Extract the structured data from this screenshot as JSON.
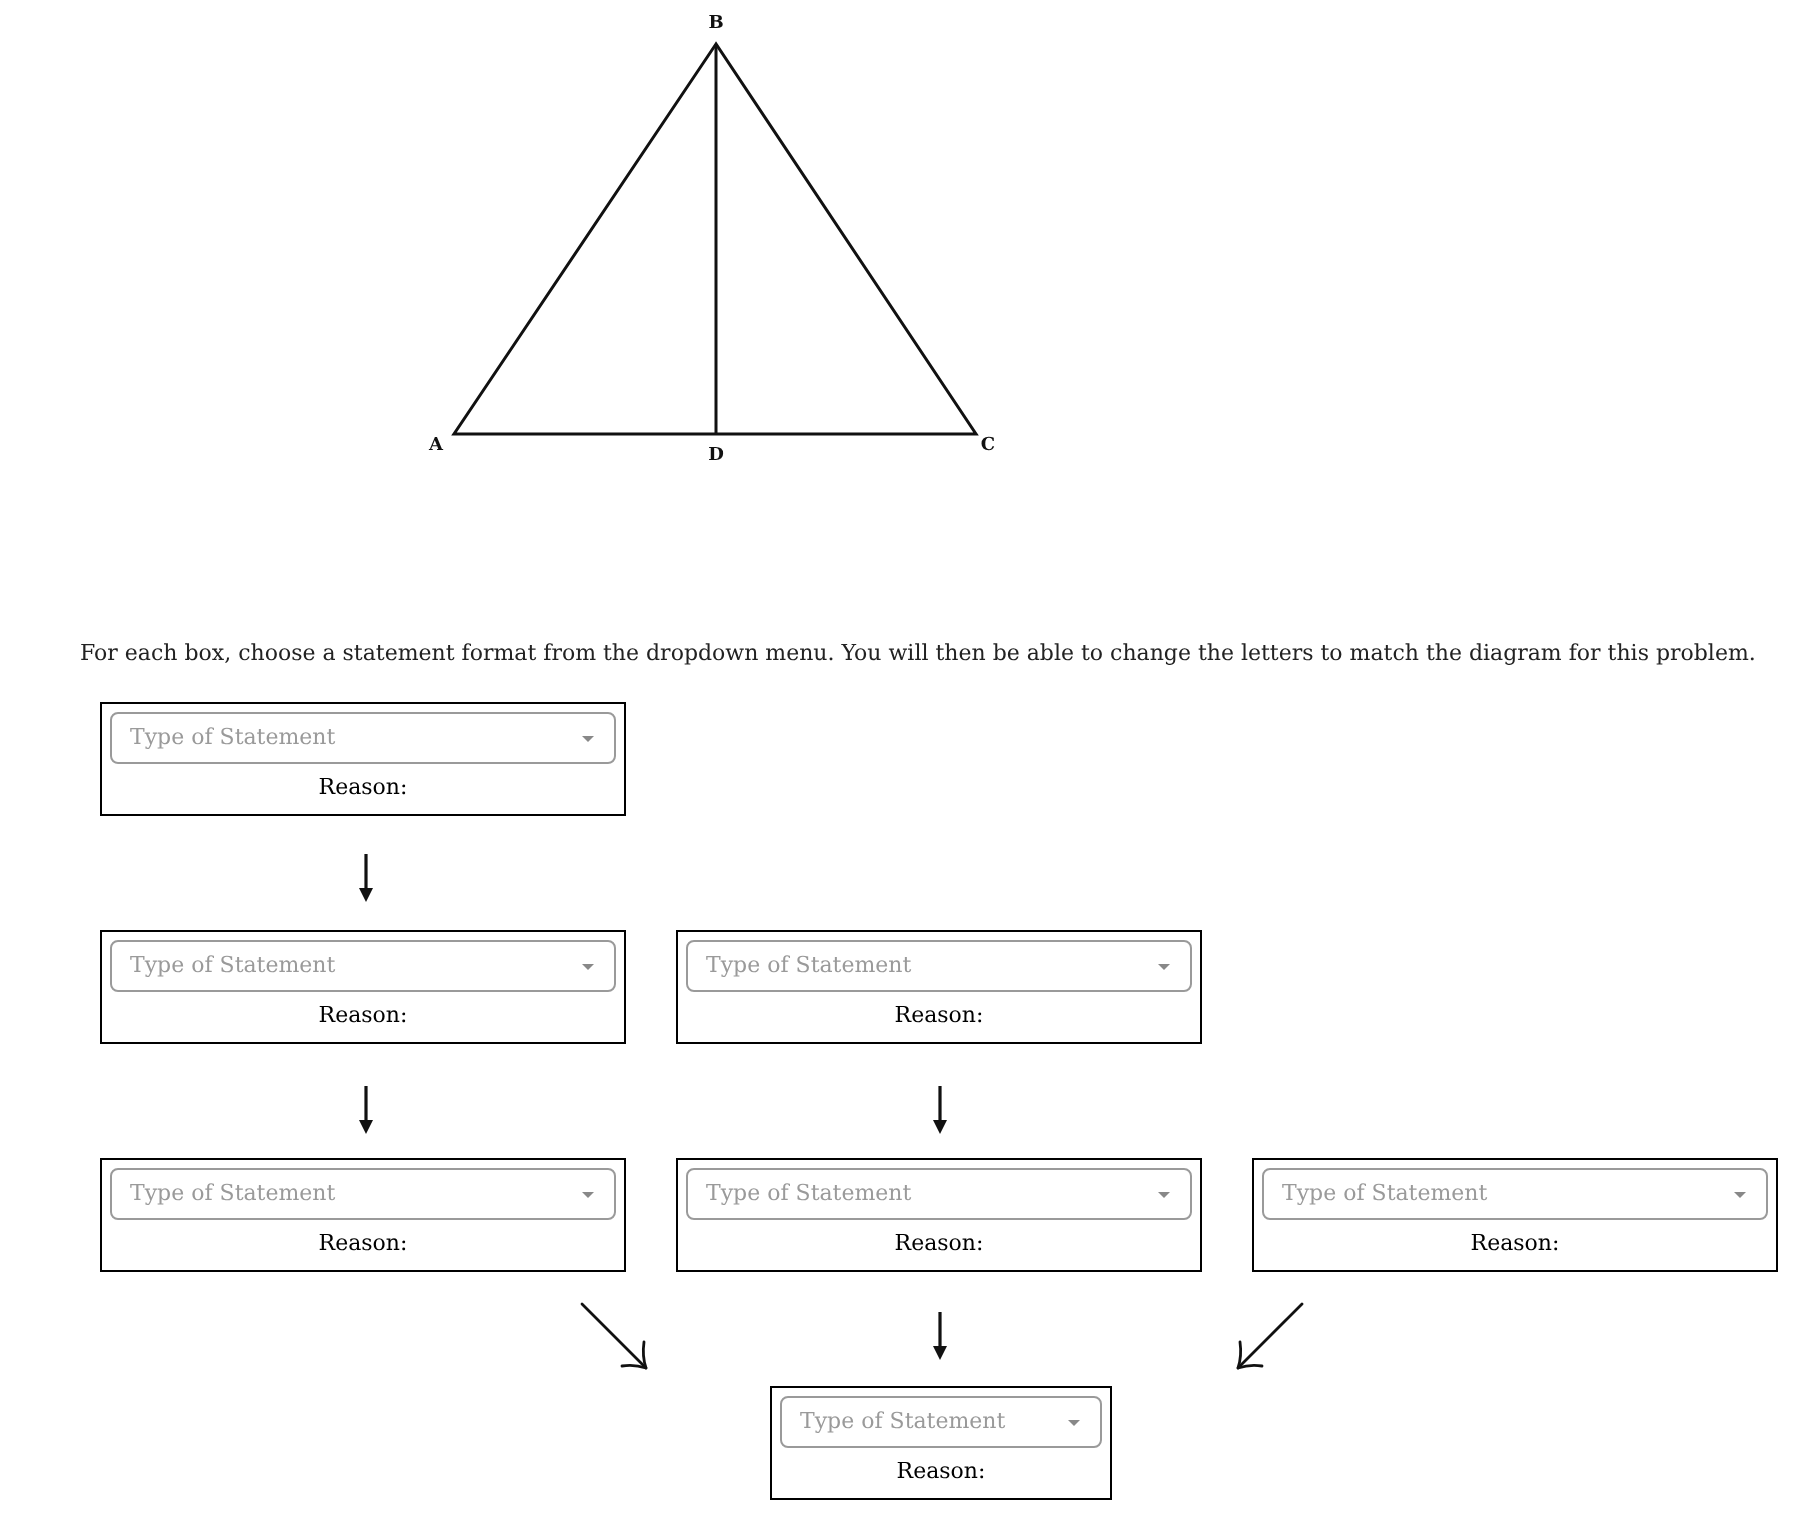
{
  "diagram": {
    "points": [
      {
        "label": "B"
      },
      {
        "label": "A"
      },
      {
        "label": "D"
      },
      {
        "label": "C"
      }
    ]
  },
  "instructions": "For each box, choose a statement format from the dropdown menu. You will then be able to change the letters to match the diagram for this problem.",
  "proof": {
    "rows": [
      {
        "boxes": [
          {
            "placeholder": "Type of Statement",
            "reason_label": "Reason:"
          }
        ]
      },
      {
        "boxes": [
          {
            "placeholder": "Type of Statement",
            "reason_label": "Reason:"
          },
          {
            "placeholder": "Type of Statement",
            "reason_label": "Reason:"
          }
        ]
      },
      {
        "boxes": [
          {
            "placeholder": "Type of Statement",
            "reason_label": "Reason:"
          },
          {
            "placeholder": "Type of Statement",
            "reason_label": "Reason:"
          },
          {
            "placeholder": "Type of Statement",
            "reason_label": "Reason:"
          }
        ]
      },
      {
        "boxes": [
          {
            "placeholder": "Type of Statement",
            "reason_label": "Reason:"
          }
        ]
      }
    ]
  }
}
